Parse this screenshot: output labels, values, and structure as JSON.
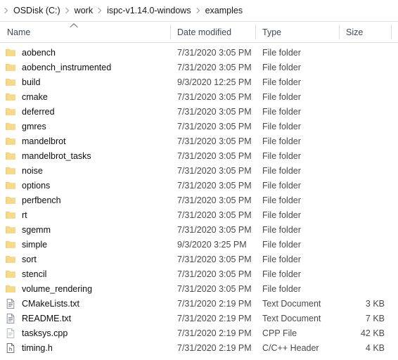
{
  "window": {
    "app": "File Explorer"
  },
  "addressbar": {
    "leading_chevron_icon": "chevron-right-icon",
    "separator": "›",
    "crumbs": [
      {
        "label": "OSDisk (C:)"
      },
      {
        "label": "work"
      },
      {
        "label": "ispc-v1.14.0-windows"
      },
      {
        "label": "examples"
      }
    ]
  },
  "columns": {
    "sort_indicator_icon": "sort-ascending-caret-icon",
    "sorted_by": "Name",
    "headers": [
      {
        "label": "Name"
      },
      {
        "label": "Date modified"
      },
      {
        "label": "Type"
      },
      {
        "label": "Size"
      }
    ]
  },
  "files": {
    "rows": [
      {
        "icon": "folder-icon",
        "name": "aobench",
        "date": "7/31/2020 3:05 PM",
        "type": "File folder",
        "size": ""
      },
      {
        "icon": "folder-icon",
        "name": "aobench_instrumented",
        "date": "7/31/2020 3:05 PM",
        "type": "File folder",
        "size": ""
      },
      {
        "icon": "folder-icon",
        "name": "build",
        "date": "9/3/2020 12:25 PM",
        "type": "File folder",
        "size": ""
      },
      {
        "icon": "folder-icon",
        "name": "cmake",
        "date": "7/31/2020 3:05 PM",
        "type": "File folder",
        "size": ""
      },
      {
        "icon": "folder-icon",
        "name": "deferred",
        "date": "7/31/2020 3:05 PM",
        "type": "File folder",
        "size": ""
      },
      {
        "icon": "folder-icon",
        "name": "gmres",
        "date": "7/31/2020 3:05 PM",
        "type": "File folder",
        "size": ""
      },
      {
        "icon": "folder-icon",
        "name": "mandelbrot",
        "date": "7/31/2020 3:05 PM",
        "type": "File folder",
        "size": ""
      },
      {
        "icon": "folder-icon",
        "name": "mandelbrot_tasks",
        "date": "7/31/2020 3:05 PM",
        "type": "File folder",
        "size": ""
      },
      {
        "icon": "folder-icon",
        "name": "noise",
        "date": "7/31/2020 3:05 PM",
        "type": "File folder",
        "size": ""
      },
      {
        "icon": "folder-icon",
        "name": "options",
        "date": "7/31/2020 3:05 PM",
        "type": "File folder",
        "size": ""
      },
      {
        "icon": "folder-icon",
        "name": "perfbench",
        "date": "7/31/2020 3:05 PM",
        "type": "File folder",
        "size": ""
      },
      {
        "icon": "folder-icon",
        "name": "rt",
        "date": "7/31/2020 3:05 PM",
        "type": "File folder",
        "size": ""
      },
      {
        "icon": "folder-icon",
        "name": "sgemm",
        "date": "7/31/2020 3:05 PM",
        "type": "File folder",
        "size": ""
      },
      {
        "icon": "folder-icon",
        "name": "simple",
        "date": "9/3/2020 3:25 PM",
        "type": "File folder",
        "size": ""
      },
      {
        "icon": "folder-icon",
        "name": "sort",
        "date": "7/31/2020 3:05 PM",
        "type": "File folder",
        "size": ""
      },
      {
        "icon": "folder-icon",
        "name": "stencil",
        "date": "7/31/2020 3:05 PM",
        "type": "File folder",
        "size": ""
      },
      {
        "icon": "folder-icon",
        "name": "volume_rendering",
        "date": "7/31/2020 3:05 PM",
        "type": "File folder",
        "size": ""
      },
      {
        "icon": "text-document-icon",
        "name": "CMakeLists.txt",
        "date": "7/31/2020 2:19 PM",
        "type": "Text Document",
        "size": "3 KB"
      },
      {
        "icon": "text-document-icon",
        "name": "README.txt",
        "date": "7/31/2020 2:19 PM",
        "type": "Text Document",
        "size": "7 KB"
      },
      {
        "icon": "cpp-file-icon",
        "name": "tasksys.cpp",
        "date": "7/31/2020 2:19 PM",
        "type": "CPP File",
        "size": "42 KB"
      },
      {
        "icon": "header-file-icon",
        "name": "timing.h",
        "date": "7/31/2020 2:19 PM",
        "type": "C/C++ Header",
        "size": "4 KB"
      }
    ]
  },
  "colors": {
    "folder": "#f7d98b",
    "folder_dark": "#e8c776",
    "background": "#ffffff",
    "header_text": "#3c4a5a",
    "secondary_text": "#4a4a4a",
    "divider": "#dcdcdc"
  }
}
